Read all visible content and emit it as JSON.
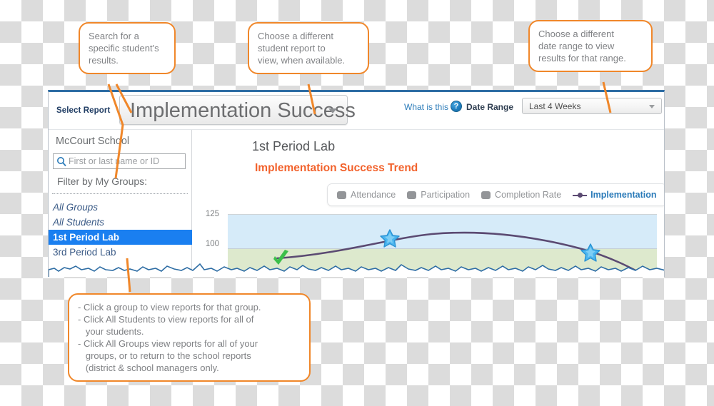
{
  "window": {
    "topbar": {
      "select_report_label": "Select Report",
      "report_value": "Implementation Success",
      "what_is_this": "What is this",
      "help_icon_glyph": "?",
      "date_range_label": "Date Range",
      "date_range_value": "Last 4 Weeks"
    },
    "sidebar": {
      "school_name": "McCourt School",
      "search_placeholder": "First or last name or ID",
      "search_value": "",
      "filter_label": "Filter by My Groups:",
      "groups": [
        {
          "label": "All Groups",
          "style": "italic",
          "selected": false
        },
        {
          "label": "All Students",
          "style": "italic",
          "selected": false
        },
        {
          "label": "1st Period Lab",
          "style": "normal",
          "selected": true
        },
        {
          "label": "3rd Period Lab",
          "style": "normal",
          "selected": false
        }
      ]
    },
    "main": {
      "title": "1st Period Lab",
      "subtitle": "Implementation Success Trend",
      "legend": [
        {
          "label": "Attendance",
          "marker": "swatch",
          "active": false
        },
        {
          "label": "Participation",
          "marker": "swatch",
          "active": false
        },
        {
          "label": "Completion Rate",
          "marker": "swatch",
          "active": false
        },
        {
          "label": "Implementation",
          "marker": "line",
          "active": true
        }
      ]
    }
  },
  "callouts": {
    "search": [
      "Search for a",
      "specific student's",
      "results."
    ],
    "report": [
      "Choose a different",
      "student report to",
      "view, when available."
    ],
    "date": [
      "Choose a different",
      "date range to view",
      "results for that range."
    ],
    "groups": [
      "- Click a group to view reports for that group.",
      "- Click All Students to view reports for all of",
      "   your students.",
      "- Click All Groups view reports for all of your",
      "   groups, or to return to the school reports",
      "   (district & school managers only."
    ]
  },
  "colors": {
    "accent_orange": "#f0872a",
    "link_blue": "#2b7bb9",
    "title_orange": "#f2622c",
    "selected_blue": "#1a7ff0",
    "band_blue": "#d6ebf9",
    "band_green": "#dde9cd",
    "trend_purple": "#5b4a72"
  },
  "chart_data": {
    "type": "line",
    "title": "Implementation Success Trend",
    "xlabel": "",
    "ylabel": "",
    "ylim": [
      75,
      131
    ],
    "yticks": [
      100,
      125
    ],
    "ytick_labels": [
      "100",
      "125"
    ],
    "grid": false,
    "legend_position": "top",
    "bands": [
      {
        "label": "upper",
        "from": 100,
        "to": 131,
        "color": "#d6ebf9"
      },
      {
        "label": "lower",
        "from": 75,
        "to": 100,
        "color": "#dde9cd"
      }
    ],
    "series": [
      {
        "name": "Implementation",
        "color": "#5b4a72",
        "x": [
          0,
          1,
          2,
          3,
          4,
          5
        ],
        "values": [
          92,
          96,
          101,
          103,
          100,
          86
        ],
        "markers": [
          {
            "x": 0,
            "type": "check-green",
            "value": 92
          },
          {
            "x": 2,
            "type": "star-blue",
            "value": 103
          },
          {
            "x": 5,
            "type": "star-blue",
            "value": 100
          }
        ]
      }
    ]
  }
}
